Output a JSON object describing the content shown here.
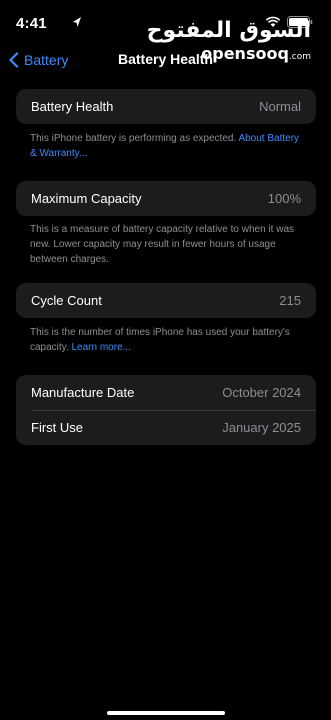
{
  "status_bar": {
    "time": "4:41"
  },
  "watermark": {
    "arabic": "السوق المفتوح",
    "latin": "opensooq",
    "suffix": ".com"
  },
  "nav": {
    "back_label": "Battery",
    "title": "Battery Health"
  },
  "sections": {
    "health": {
      "label": "Battery Health",
      "value": "Normal",
      "footnote_text": "This iPhone battery is performing as expected. ",
      "footnote_link": "About Battery & Warranty..."
    },
    "capacity": {
      "label": "Maximum Capacity",
      "value": "100%",
      "footnote_text": "This is a measure of battery capacity relative to when it was new. Lower capacity may result in fewer hours of usage between charges."
    },
    "cycles": {
      "label": "Cycle Count",
      "value": "215",
      "footnote_text": "This is the number of times iPhone has used your battery's capacity. ",
      "footnote_link": "Learn more..."
    },
    "dates": {
      "manufacture_label": "Manufacture Date",
      "manufacture_value": "October 2024",
      "first_use_label": "First Use",
      "first_use_value": "January 2025"
    }
  },
  "colors": {
    "background": "#000000",
    "card": "#1c1c1e",
    "accent": "#3d8bfd",
    "secondary_text": "#8e8e93"
  }
}
